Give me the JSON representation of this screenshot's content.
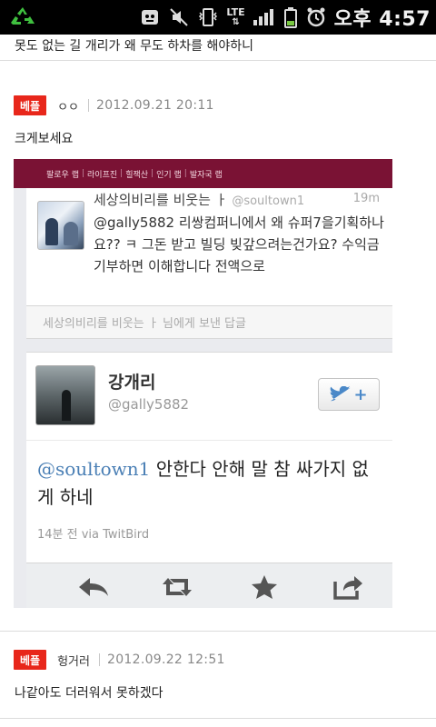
{
  "status_bar": {
    "time": "오후 4:57",
    "network": "LTE",
    "icons": [
      "recycle-icon",
      "no-sim-icon",
      "mute-icon",
      "vibrate-icon",
      "signal-icon",
      "battery-icon",
      "alarm-icon"
    ]
  },
  "previous_comment": {
    "text": "못도 없는 길 개리가 왜 무도 하차를 해야하니"
  },
  "comments": [
    {
      "badge": "베플",
      "author": "ㅇㅇ",
      "date": "2012.09.21 20:11",
      "text": "크게보세요"
    },
    {
      "badge": "베플",
      "author": "헝거러",
      "date": "2012.09.22 12:51",
      "text": "나같아도 더러워서 못하겠다"
    }
  ],
  "embedded_screenshot": {
    "nav_items": [
      "팔로우 랩",
      "라이프진",
      "힐잭산",
      "인기 랩",
      "발자국 랩"
    ],
    "tweet1": {
      "name": "세상의비리를 비웃는 ㅏ",
      "handle": "@soultown1",
      "time": "19m",
      "text": "@gally5882 리쌍컴퍼니에서 왜 슈퍼7을기획하나요?? ㅋ 그돈 받고 빌딩 빚갚으려는건가요? 수익금 기부하면 이해합니다 전액으로"
    },
    "reply_bar": "세상의비리를 비웃는 ㅏ 님에게 보낸 답글",
    "tweet2": {
      "name": "강개리",
      "handle": "@gally5882",
      "mention": "@soultown1",
      "text": " 안한다 안해 말 참 싸가지 없게 하네",
      "meta": "14분 전 via TwitBird"
    },
    "accent_color": "#7a1234"
  }
}
